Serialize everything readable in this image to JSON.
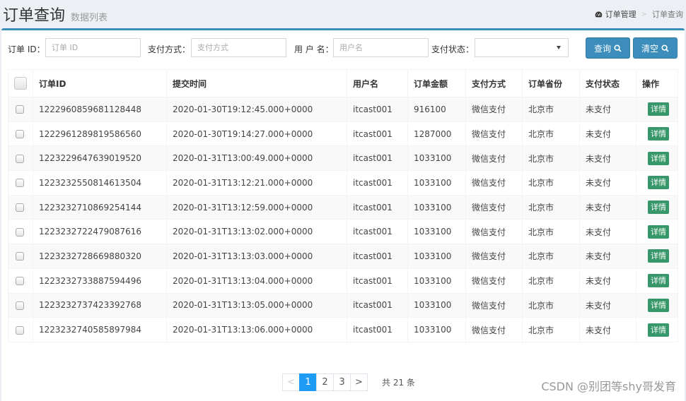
{
  "header": {
    "title": "订单查询",
    "subtitle": "数据列表",
    "breadcrumb": [
      {
        "label": "订单管理",
        "icon": "dashboard-icon"
      },
      {
        "label": "订单查询"
      }
    ]
  },
  "filters": {
    "order_id": {
      "label": "订单 ID：",
      "placeholder": "订单 ID",
      "value": ""
    },
    "pay_method": {
      "label": "支付方式：",
      "placeholder": "支付方式",
      "value": ""
    },
    "username": {
      "label": "用 户 名：",
      "placeholder": "用户名",
      "value": ""
    },
    "pay_status": {
      "label": "支付状态：",
      "selected": ""
    },
    "search_button": "查询",
    "clear_button": "清空"
  },
  "table": {
    "columns": [
      "订单ID",
      "提交时间",
      "用户名",
      "订单金额",
      "支付方式",
      "订单省份",
      "支付状态",
      "操作"
    ],
    "detail_label": "详情",
    "rows": [
      {
        "id": "1222960859681128448",
        "time": "2020-01-30T19:12:45.000+0000",
        "user": "itcast001",
        "amount": "916100",
        "method": "微信支付",
        "province": "北京市",
        "status": "未支付"
      },
      {
        "id": "1222961289819586560",
        "time": "2020-01-30T19:14:27.000+0000",
        "user": "itcast001",
        "amount": "1287000",
        "method": "微信支付",
        "province": "北京市",
        "status": "未支付"
      },
      {
        "id": "1223229647639019520",
        "time": "2020-01-31T13:00:49.000+0000",
        "user": "itcast001",
        "amount": "1033100",
        "method": "微信支付",
        "province": "北京市",
        "status": "未支付"
      },
      {
        "id": "1223232550814613504",
        "time": "2020-01-31T13:12:21.000+0000",
        "user": "itcast001",
        "amount": "1033100",
        "method": "微信支付",
        "province": "北京市",
        "status": "未支付"
      },
      {
        "id": "1223232710869254144",
        "time": "2020-01-31T13:12:59.000+0000",
        "user": "itcast001",
        "amount": "1033100",
        "method": "微信支付",
        "province": "北京市",
        "status": "未支付"
      },
      {
        "id": "1223232722479087616",
        "time": "2020-01-31T13:13:02.000+0000",
        "user": "itcast001",
        "amount": "1033100",
        "method": "微信支付",
        "province": "北京市",
        "status": "未支付"
      },
      {
        "id": "1223232728669880320",
        "time": "2020-01-31T13:13:03.000+0000",
        "user": "itcast001",
        "amount": "1033100",
        "method": "微信支付",
        "province": "北京市",
        "status": "未支付"
      },
      {
        "id": "1223232733887594496",
        "time": "2020-01-31T13:13:04.000+0000",
        "user": "itcast001",
        "amount": "1033100",
        "method": "微信支付",
        "province": "北京市",
        "status": "未支付"
      },
      {
        "id": "1223232737423392768",
        "time": "2020-01-31T13:13:05.000+0000",
        "user": "itcast001",
        "amount": "1033100",
        "method": "微信支付",
        "province": "北京市",
        "status": "未支付"
      },
      {
        "id": "1223232740585897984",
        "time": "2020-01-31T13:13:06.000+0000",
        "user": "itcast001",
        "amount": "1033100",
        "method": "微信支付",
        "province": "北京市",
        "status": "未支付"
      }
    ]
  },
  "pagination": {
    "prev": "<",
    "next": ">",
    "pages": [
      "1",
      "2",
      "3"
    ],
    "current": "1",
    "total_text": "共 21 条"
  },
  "watermark": "CSDN @别团等shy哥发育",
  "colors": {
    "primary": "#3c8dbc",
    "success": "#38976a",
    "page_active": "#1e9cf5"
  }
}
